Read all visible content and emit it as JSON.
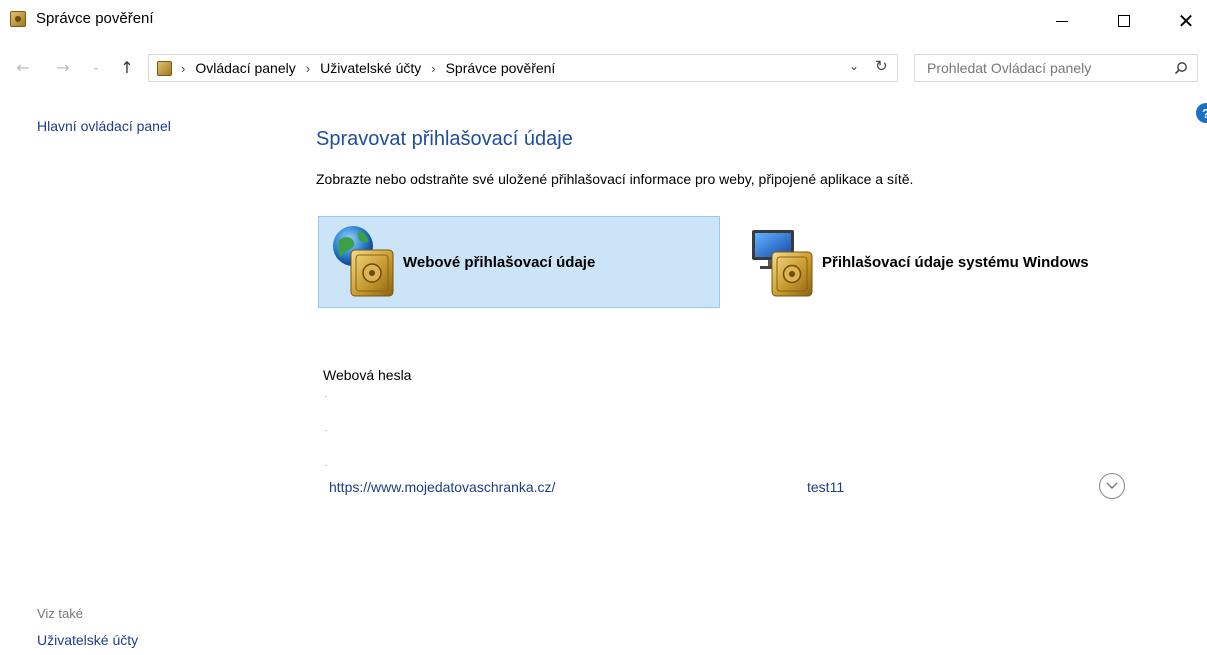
{
  "window": {
    "title": "Správce pověření"
  },
  "address": {
    "breadcrumbs": [
      "Ovládací panely",
      "Uživatelské účty",
      "Správce pověření"
    ],
    "search_placeholder": "Prohledat Ovládací panely"
  },
  "left_pane": {
    "home_link": "Hlavní ovládací panel",
    "see_also_label": "Viz také",
    "see_also_link": "Uživatelské účty"
  },
  "main": {
    "heading": "Spravovat přihlašovací údaje",
    "description": "Zobrazte nebo odstraňte své uložené přihlašovací informace pro weby, připojené aplikace a sítě.",
    "tiles": {
      "web_label": "Webové přihlašovací údaje",
      "windows_label": "Přihlašovací údaje systému Windows"
    },
    "section_title": "Webová hesla",
    "credentials": [
      {
        "url": "https://www.mojedatovaschranka.cz/",
        "user": "test11"
      }
    ]
  },
  "colors": {
    "link": "#1e3c8a",
    "heading": "#1f4e9a",
    "selected_tile_bg": "#cce4f7",
    "help_icon": "#1c6fc4"
  },
  "icons": {
    "app": "credential-vault-icon",
    "help": "help-icon",
    "web_tile": "globe-vault-icon",
    "windows_tile": "monitor-vault-icon",
    "expand": "chevron-down-circle-icon"
  }
}
